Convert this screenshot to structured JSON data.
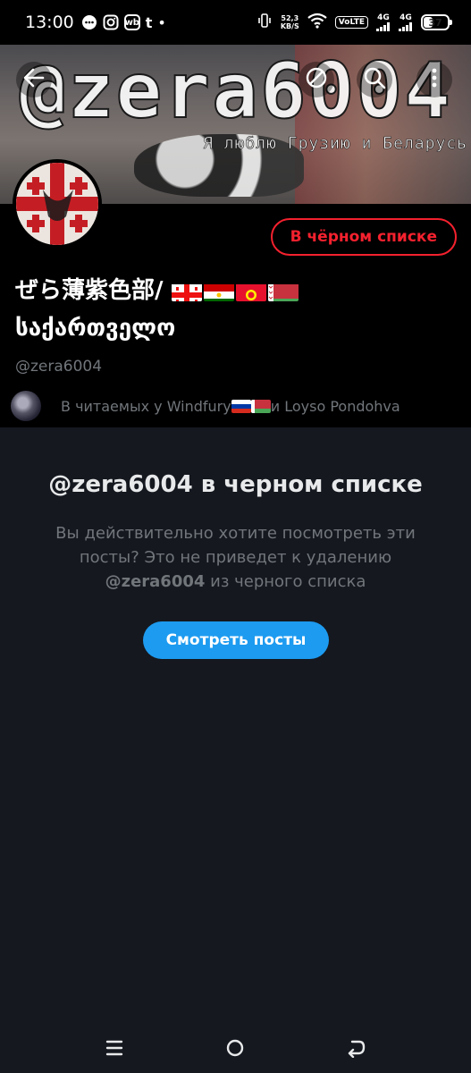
{
  "status_bar": {
    "time": "13:00",
    "speed_value": "52,3",
    "speed_unit": "KB/S",
    "volte": "VoLTE",
    "network_1": "4G",
    "network_2": "4G",
    "battery": "37"
  },
  "banner": {
    "watermark_text": "@zera6004",
    "tagline": "Я люблю Грузию и Беларусь"
  },
  "profile": {
    "blocked_button_label": "В чёрном списке",
    "display_name_part1": "ぜら薄紫色部/",
    "display_name_part2": "საქართველო",
    "handle": "@zera6004",
    "followed_prefix": "В читаемых у Windfury",
    "followed_suffix": " и Loyso Pondohva"
  },
  "notice": {
    "title": "@zera6004 в черном списке",
    "text_line": "Вы действительно хотите посмотреть эти посты? Это не приведет к удалению",
    "text_handle": "@zera6004",
    "text_end": " из черного списка",
    "button_label": "Смотреть посты"
  },
  "colors": {
    "accent_blue": "#1d9bf0",
    "blocked_red": "#f4212e",
    "background": "#15181f",
    "secondary_text": "#71767b"
  },
  "icons": {
    "back": "arrow-left-icon",
    "mute": "no-sign-icon",
    "search": "search-icon",
    "more": "more-vertical-icon"
  }
}
